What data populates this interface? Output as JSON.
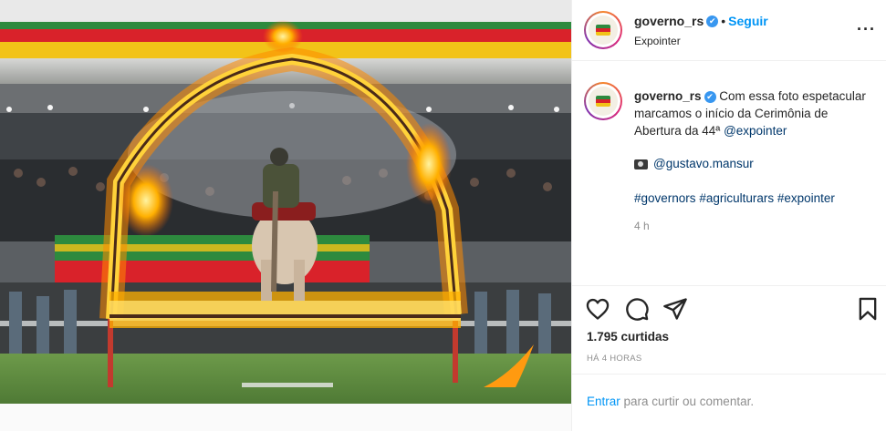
{
  "post": {
    "username": "governo_rs",
    "verified_mark": "✔",
    "follow_label": "Seguir",
    "location": "Expointer",
    "more_label": "···",
    "caption_text": "Com essa foto espetacular marcamos o início da Cerimônia de Abertura da 44ª",
    "caption_mention": "@expointer",
    "credit_mention": "@gustavo.mansur",
    "hashtags": [
      "#governors",
      "#agriculturars",
      "#expointer"
    ],
    "comment_age": "4 h",
    "likes": "1.795 curtidas",
    "posted_ago": "HÁ 4 HORAS",
    "login_link": "Entrar",
    "login_text": " para curtir ou comentar."
  },
  "icons": {
    "more": "more-options-icon",
    "verified": "verified-badge-icon",
    "like": "heart-icon",
    "comment": "comment-icon",
    "share": "share-icon",
    "save": "bookmark-icon",
    "camera": "camera-icon"
  },
  "colors": {
    "link_blue": "#0095f6",
    "mention_dark_blue": "#00376b",
    "muted_gray": "#8e8e8e",
    "flag_green": "#2d8a3e",
    "flag_red": "#d9222a",
    "flag_yellow": "#f2c318",
    "fire_orange": "#ff8a00"
  }
}
